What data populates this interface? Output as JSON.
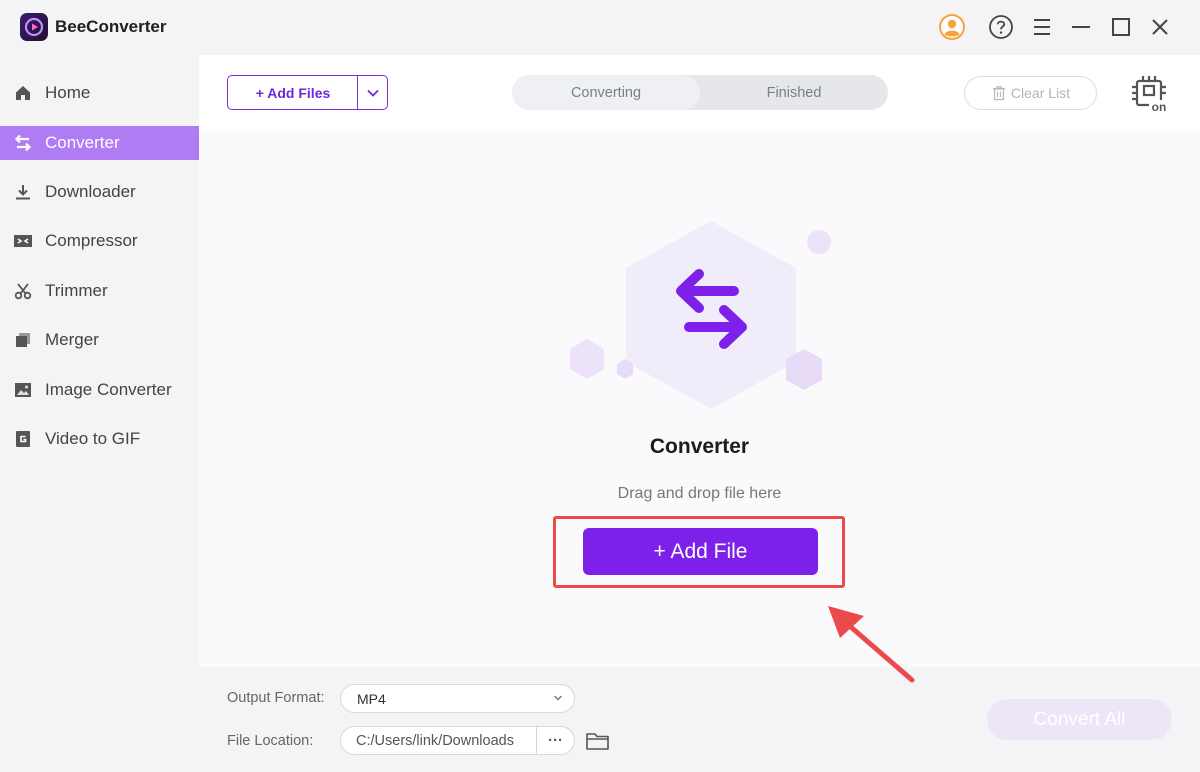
{
  "app": {
    "title": "BeeConverter"
  },
  "titlebar": {
    "icons": [
      "account-icon",
      "help-icon",
      "menu-icon",
      "minimize-icon",
      "maximize-icon",
      "close-icon"
    ]
  },
  "sidebar": {
    "items": [
      {
        "label": "Home",
        "icon": "home-icon",
        "active": false
      },
      {
        "label": "Converter",
        "icon": "converter-icon",
        "active": true
      },
      {
        "label": "Downloader",
        "icon": "download-icon",
        "active": false
      },
      {
        "label": "Compressor",
        "icon": "compressor-icon",
        "active": false
      },
      {
        "label": "Trimmer",
        "icon": "scissors-icon",
        "active": false
      },
      {
        "label": "Merger",
        "icon": "merger-icon",
        "active": false
      },
      {
        "label": "Image Converter",
        "icon": "image-icon",
        "active": false
      },
      {
        "label": "Video to GIF",
        "icon": "gif-icon",
        "active": false
      }
    ]
  },
  "toolbar": {
    "add_files_label": "+ Add Files",
    "tabs": [
      {
        "label": "Converting",
        "active": true
      },
      {
        "label": "Finished",
        "active": false
      }
    ],
    "clear_list_label": "Clear List",
    "gpu_label": "on"
  },
  "dropzone": {
    "title": "Converter",
    "subtitle": "Drag and drop file here",
    "add_file_label": "+ Add File"
  },
  "bottom": {
    "output_format_label": "Output Format:",
    "output_format_value": "MP4",
    "file_location_label": "File Location:",
    "file_location_value": "C:/Users/link/Downloads",
    "more_label": "···",
    "convert_all_label": "Convert All"
  },
  "colors": {
    "accent": "#7d21ea",
    "sidebar_active": "#b07cf4",
    "highlight": "#ec4a4a"
  }
}
